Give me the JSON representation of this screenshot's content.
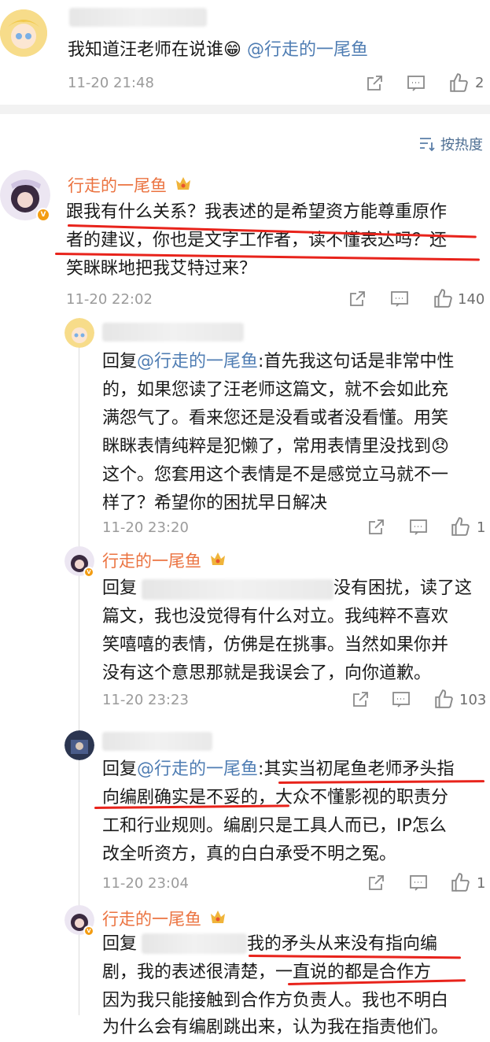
{
  "top_comment": {
    "text": "我知道汪老师在说谁😁",
    "mention": "@行走的一尾鱼",
    "time": "11-20 21:48",
    "likes": "2"
  },
  "sort": {
    "label": "按热度"
  },
  "comment_main": {
    "author": "行走的一尾鱼",
    "lines": [
      "跟我有什么关系？我表述的是希望资方能尊重原作",
      "者的建议，你也是文字工作者，读不懂表达吗？还",
      "笑眯眯地把我艾特过来？"
    ],
    "time": "11-20 22:02",
    "likes": "140"
  },
  "reply1": {
    "prefix": "回复",
    "mention": "@行走的一尾鱼",
    "lines_first": ":首先我这句话是非常中性",
    "lines": [
      "的，如果您读了汪老师这篇文，就不会如此充",
      "满怨气了。看来您还是没看或者没看懂。用笑",
      "眯眯表情纯粹是犯懒了，常用表情里没找到😞",
      "这个。您套用这个表情是不是感觉立马就不一",
      "样了？希望你的困扰早日解决"
    ],
    "time": "11-20 23:20",
    "likes": "1"
  },
  "reply2": {
    "author": "行走的一尾鱼",
    "prefix": "回复",
    "first_tail": "没有困扰，读了这",
    "lines": [
      "篇文，我也没觉得有什么对立。我纯粹不喜欢",
      "笑嘻嘻的表情，仿佛是在挑事。当然如果你并",
      "没有这个意思那就是我误会了，向你道歉。"
    ],
    "time": "11-20 23:23",
    "likes": "103"
  },
  "reply3": {
    "prefix": "回复",
    "mention": "@行走的一尾鱼",
    "first_tail": ":其实当初尾鱼老师矛头指",
    "lines": [
      "向编剧确实是不妥的，大众不懂影视的职责分",
      "工和行业规则。编剧只是工具人而已，IP怎么",
      "改全听资方，真的白白承受不明之冤。"
    ],
    "time": "11-20 23:04",
    "likes": "1"
  },
  "reply4": {
    "author": "行走的一尾鱼",
    "prefix": "回复",
    "first_tail": "我的矛头从来没有指向编",
    "lines": [
      "剧，我的表述很清楚，一直说的都是合作方",
      "因为我只能接触到合作方负责人。我也不明白",
      "为什么会有编剧跳出来，认为我在指责他们。"
    ]
  },
  "colors": {
    "name": "#eb7340",
    "mention": "#4f7db3",
    "underline": "#e8231b"
  }
}
